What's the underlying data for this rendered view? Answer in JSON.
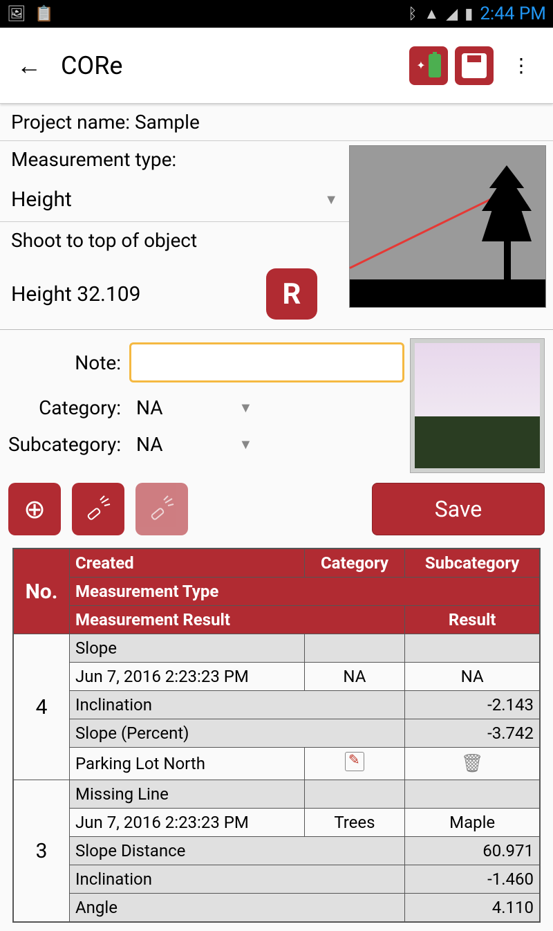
{
  "status": {
    "time": "2:44 PM"
  },
  "app": {
    "title": "CORe"
  },
  "info": {
    "project_label": "Project name:",
    "project_value": "Sample",
    "measurement_type_label": "Measurement type:",
    "measurement_type_value": "Height",
    "instruction": "Shoot to top of object",
    "height_label": "Height",
    "height_value": "32.109",
    "r_label": "R"
  },
  "form": {
    "note_label": "Note:",
    "note_value": "",
    "category_label": "Category:",
    "category_value": "NA",
    "subcategory_label": "Subcategory:",
    "subcategory_value": "NA",
    "save_label": "Save"
  },
  "headers": {
    "no": "No.",
    "created": "Created",
    "category": "Category",
    "subcategory": "Subcategory",
    "measurement_type": "Measurement Type",
    "measurement_result": "Measurement Result",
    "result": "Result"
  },
  "rows": [
    {
      "no": "4",
      "slope_label": "Slope",
      "created": "Jun 7, 2016 2:23:23 PM",
      "category": "NA",
      "subcategory": "NA",
      "m1_label": "Inclination",
      "m1_value": "-2.143",
      "m2_label": "Slope (Percent)",
      "m2_value": "-3.742",
      "note": "Parking Lot North"
    },
    {
      "no": "3",
      "slope_label": "Missing Line",
      "created": "Jun 7, 2016 2:23:23 PM",
      "category": "Trees",
      "subcategory": "Maple",
      "m1_label": "Slope Distance",
      "m1_value": "60.971",
      "m2_label": "Inclination",
      "m2_value": "-1.460",
      "m3_label": "Angle",
      "m3_value": "4.110"
    }
  ]
}
